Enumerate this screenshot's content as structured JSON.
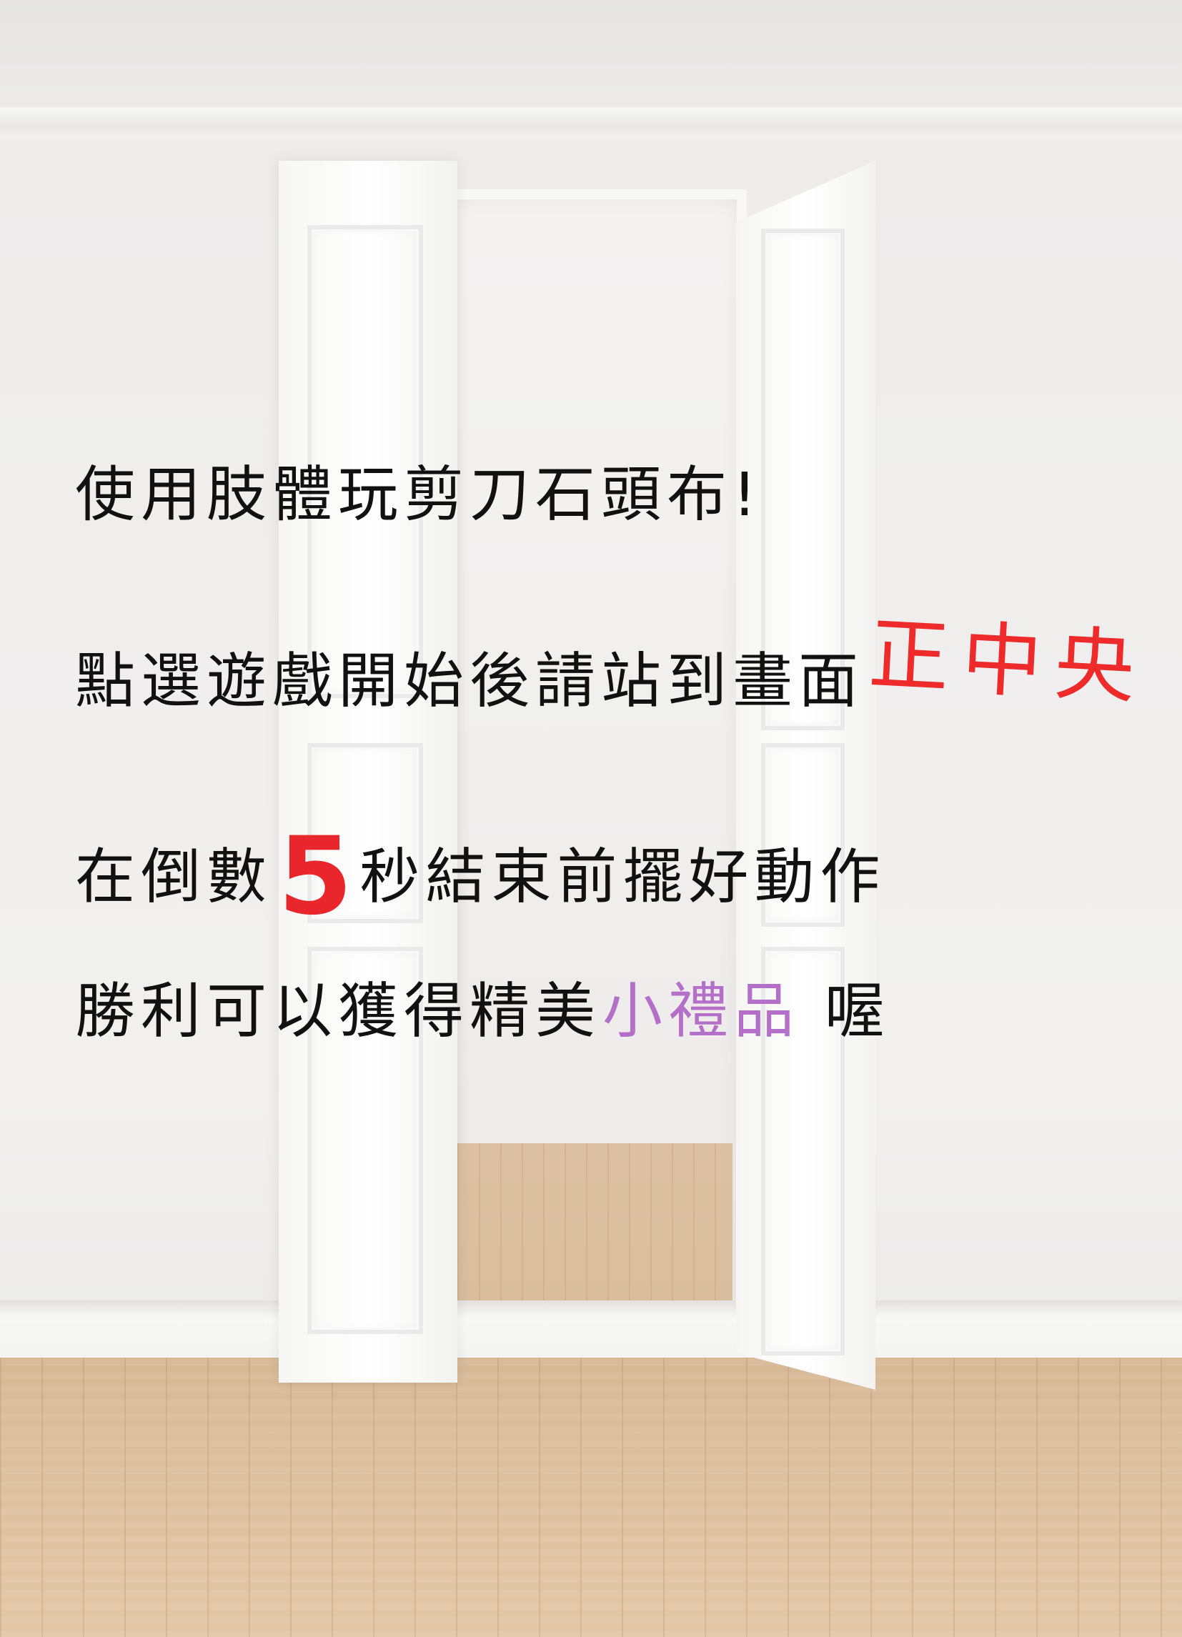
{
  "lines": {
    "line1": "使用肢體玩剪刀石頭布!",
    "line2_main": "點選遊戲開始後請站到畫面",
    "line2_emphasis": "正中央",
    "line3_before": "在倒數",
    "line3_number": "5",
    "line3_after": "秒結束前擺好動作",
    "line4_main": "勝利可以獲得精美",
    "line4_emphasis": "小禮品",
    "line4_end": " 喔"
  },
  "colors": {
    "text": "#111111",
    "emphasis_red": "#ee2a2a",
    "emphasis_purple": "#b46fc9"
  }
}
